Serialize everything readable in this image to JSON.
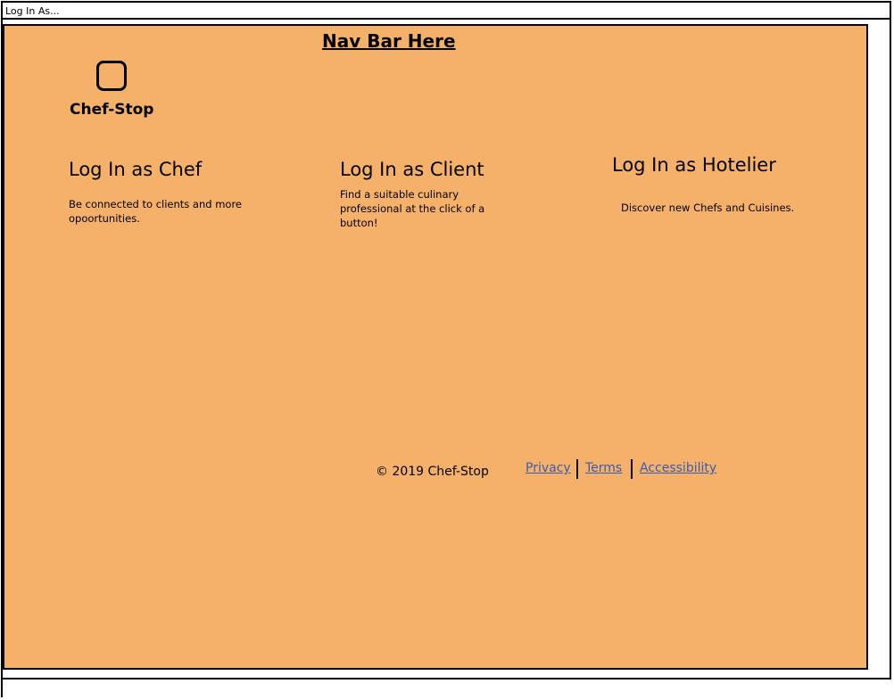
{
  "window": {
    "title": "Log In As..."
  },
  "header": {
    "nav_title": "Nav Bar Here",
    "logo_text": "Chef-Stop"
  },
  "options": {
    "chef": {
      "heading": "Log In as Chef",
      "description": "Be connected to clients and more opoortunities."
    },
    "client": {
      "heading": "Log In as Client",
      "description": "Find a suitable culinary professional at the click of a button!"
    },
    "hotelier": {
      "heading": "Log In as Hotelier",
      "description": "Discover new Chefs and Cuisines."
    }
  },
  "footer": {
    "copyright": "© 2019 Chef-Stop",
    "links": {
      "privacy": "Privacy",
      "terms": "Terms",
      "accessibility": "Accessibility"
    }
  },
  "colors": {
    "background": "#f5b06a",
    "link": "#3a5bb5"
  }
}
